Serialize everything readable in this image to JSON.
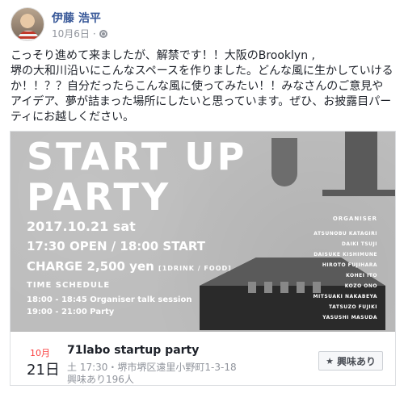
{
  "post": {
    "author": "伊藤 浩平",
    "date": "10月6日",
    "sep": "·",
    "text": "こっそり進めて来ましたが、解禁です！！大阪のBrooklyn ,\n堺の大和川沿いにこんなスペースを作りました。どんな風に生かしていけるか！！？？自分だったらこんな風に使ってみたい！！みなさんのご意見やアイデア、夢が詰まった場所にしたいと思っています。ぜひ、お披露目パーティにお越しください。"
  },
  "poster": {
    "title_line1": "START UP",
    "title_line2": "PARTY",
    "date": "2017.10.21 sat",
    "time": "17:30 OPEN / 18:00 START",
    "charge_main": "CHARGE 2,500 yen",
    "charge_note": "[1DRINK / FOOD]",
    "schedule_heading": "TIME SCHEDULE",
    "schedule": [
      "18:00 - 18:45  Organiser talk session",
      "19:00 - 21:00  Party"
    ],
    "organiser_heading": "ORGANISER",
    "organisers": [
      "ATSUNOBU KATAGIRI",
      "DAIKI TSUJI",
      "DAISUKE KISHIMUNE",
      "HIROTO FUJIHARA",
      "KOHEI ITO",
      "KOZO ONO",
      "MITSUAKI NAKABEYA",
      "TATSUZO FUJIKI",
      "YASUSHI MASUDA"
    ]
  },
  "event": {
    "month": "10月",
    "day": "21日",
    "title": "71labo startup party",
    "location": "土 17:30・堺市堺区遠里小野町1-3-18",
    "interested_count": "興味あり196人",
    "interest_button": "興味あり",
    "star_icon": "star-icon"
  },
  "colors": {
    "author_link": "#385898",
    "muted": "#90949c",
    "month_red": "#fa3e3e",
    "poster_bg": "#bdbdbd"
  }
}
